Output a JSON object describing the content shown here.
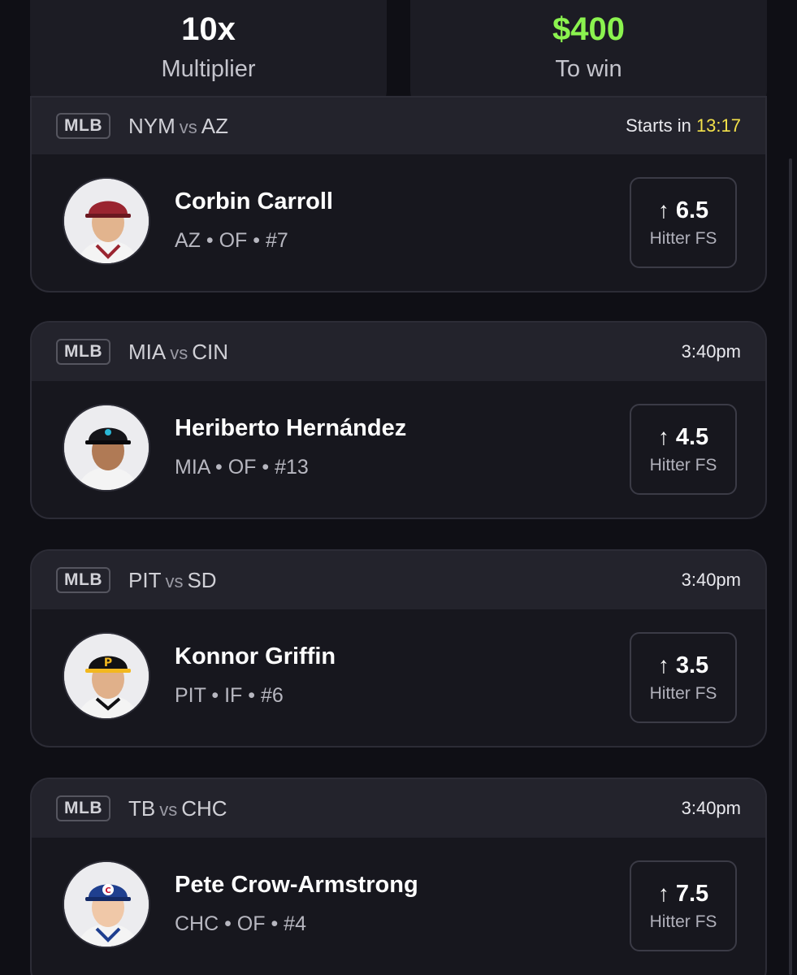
{
  "summary": {
    "multiplier_value": "10x",
    "multiplier_label": "Multiplier",
    "payout_value": "$400",
    "payout_label": "To win"
  },
  "picks": [
    {
      "league": "MLB",
      "team_a": "NYM",
      "vs": "vs",
      "team_b": "AZ",
      "start_prefix": "Starts in ",
      "start_time": "13:17",
      "player_name": "Corbin Carroll",
      "player_meta": "AZ • OF • #7",
      "direction_icon": "arrow-up-icon",
      "line": "6.5",
      "stat": "Hitter FS",
      "cap_color": "#9a2530"
    },
    {
      "league": "MLB",
      "team_a": "MIA",
      "vs": "vs",
      "team_b": "CIN",
      "start_time": "3:40pm",
      "player_name": "Heriberto Hernández",
      "player_meta": "MIA • OF • #13",
      "direction_icon": "arrow-up-icon",
      "line": "4.5",
      "stat": "Hitter FS",
      "cap_color": "#15151a"
    },
    {
      "league": "MLB",
      "team_a": "PIT",
      "vs": "vs",
      "team_b": "SD",
      "start_time": "3:40pm",
      "player_name": "Konnor Griffin",
      "player_meta": "PIT • IF • #6",
      "direction_icon": "arrow-up-icon",
      "line": "3.5",
      "stat": "Hitter FS",
      "cap_color": "#111114"
    },
    {
      "league": "MLB",
      "team_a": "TB",
      "vs": "vs",
      "team_b": "CHC",
      "start_time": "3:40pm",
      "player_name": "Pete Crow-Armstrong",
      "player_meta": "CHC • OF • #4",
      "direction_icon": "arrow-up-icon",
      "line": "7.5",
      "stat": "Hitter FS",
      "cap_color": "#1f3f8f"
    }
  ],
  "colors": {
    "background": "#0f0f15",
    "card": "#17171e",
    "header": "#23232c",
    "accent_green": "#8bf34f",
    "timer_yellow": "#f3e14a"
  }
}
